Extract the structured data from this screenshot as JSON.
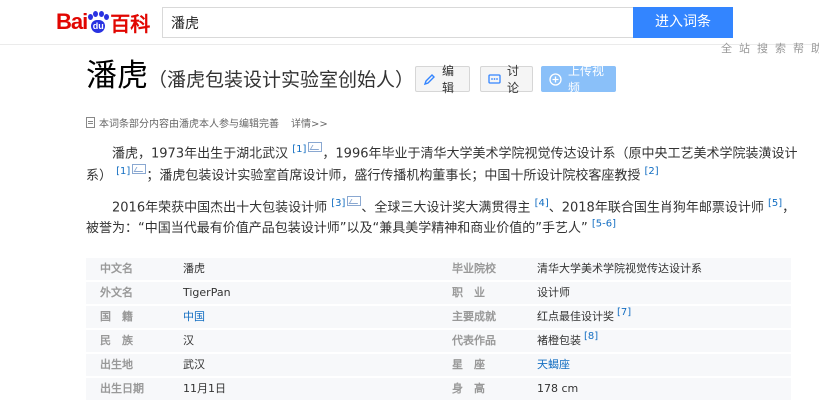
{
  "header": {
    "logo_bai": "Bai",
    "logo_du": "du",
    "logo_baike": "百科",
    "search_value": "潘虎",
    "search_button": "进入词条"
  },
  "fade_nav": [
    "全",
    "站",
    "搜",
    "索",
    "帮",
    "助"
  ],
  "entry": {
    "title": "潘虎",
    "subtitle": "（潘虎包装设计实验室创始人）",
    "edit_label": "编辑",
    "discuss_label": "讨论",
    "upload_label": "上传视频"
  },
  "notice": {
    "text": "本词条部分内容由潘虎本人参与编辑完善",
    "more": "详情>>"
  },
  "summary": {
    "p1_a": "潘虎，1973年出生于湖北武汉",
    "p1_ref1": "[1]",
    "p1_b": "，1996年毕业于清华大学美术学院视觉传达设计系（原中央工艺美术学院装潢设计系）",
    "p1_ref2": "[1]",
    "p1_c": "；潘虎包装设计实验室首席设计师，盛行传播机构董事长；中国十所设计院校客座教授",
    "p1_ref3": "[2]",
    "p2_a": "2016年荣获中国杰出十大包装设计师",
    "p2_ref1": "[3]",
    "p2_b": "、全球三大设计奖大满贯得主",
    "p2_ref2": "[4]",
    "p2_c": "、2018年联合国生肖狗年邮票设计师",
    "p2_ref3": "[5]",
    "p2_d": "，被誉为：“中国当代最有价值产品包装设计师”以及“兼具美学精神和商业价值的”手艺人”",
    "p2_ref4": "[5-6]"
  },
  "basic_info": {
    "left": [
      {
        "name": "中文名",
        "value": "潘虎"
      },
      {
        "name": "外文名",
        "value": "TigerPan"
      },
      {
        "name": "国　籍",
        "value": "中国"
      },
      {
        "name": "民　族",
        "value": "汉"
      },
      {
        "name": "出生地",
        "value": "武汉"
      },
      {
        "name": "出生日期",
        "value": "11月1日"
      }
    ],
    "right": [
      {
        "name": "毕业院校",
        "value": "清华大学美术学院视觉传达设计系"
      },
      {
        "name": "职　业",
        "value": "设计师"
      },
      {
        "name": "主要成就",
        "value": "红点最佳设计奖",
        "ref": "[7]"
      },
      {
        "name": "代表作品",
        "value": "褚橙包装",
        "ref": "[8]"
      },
      {
        "name": "星　座",
        "value": "天蝎座"
      },
      {
        "name": "身　高",
        "value": "178 cm"
      }
    ]
  }
}
